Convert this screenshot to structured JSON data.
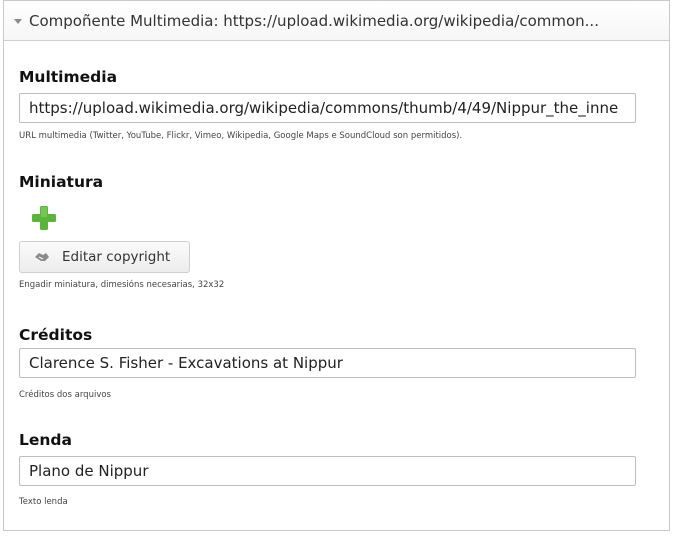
{
  "panel": {
    "title": "Compoñente Multimedia: https://upload.wikimedia.org/wikipedia/common..."
  },
  "multimedia": {
    "label": "Multimedia",
    "value": "https://upload.wikimedia.org/wikipedia/commons/thumb/4/49/Nippur_the_inne",
    "help": "URL multimedia (Twitter, YouTube, Flickr, Vimeo, Wikipedia, Google Maps e SoundCloud son permitidos)."
  },
  "thumbnail": {
    "label": "Miniatura",
    "add_icon": "plus-icon",
    "copyright_button": "Editar copyright",
    "help": "Engadir miniatura, dimesións necesarias, 32x32"
  },
  "credits": {
    "label": "Créditos",
    "value": "Clarence S. Fisher - Excavations at Nippur",
    "help": "Créditos dos arquivos"
  },
  "caption": {
    "label": "Lenda",
    "value": "Plano de Nippur",
    "help": "Texto lenda"
  },
  "colors": {
    "plus_green": "#5bb53a",
    "border": "#bdbdbd"
  }
}
